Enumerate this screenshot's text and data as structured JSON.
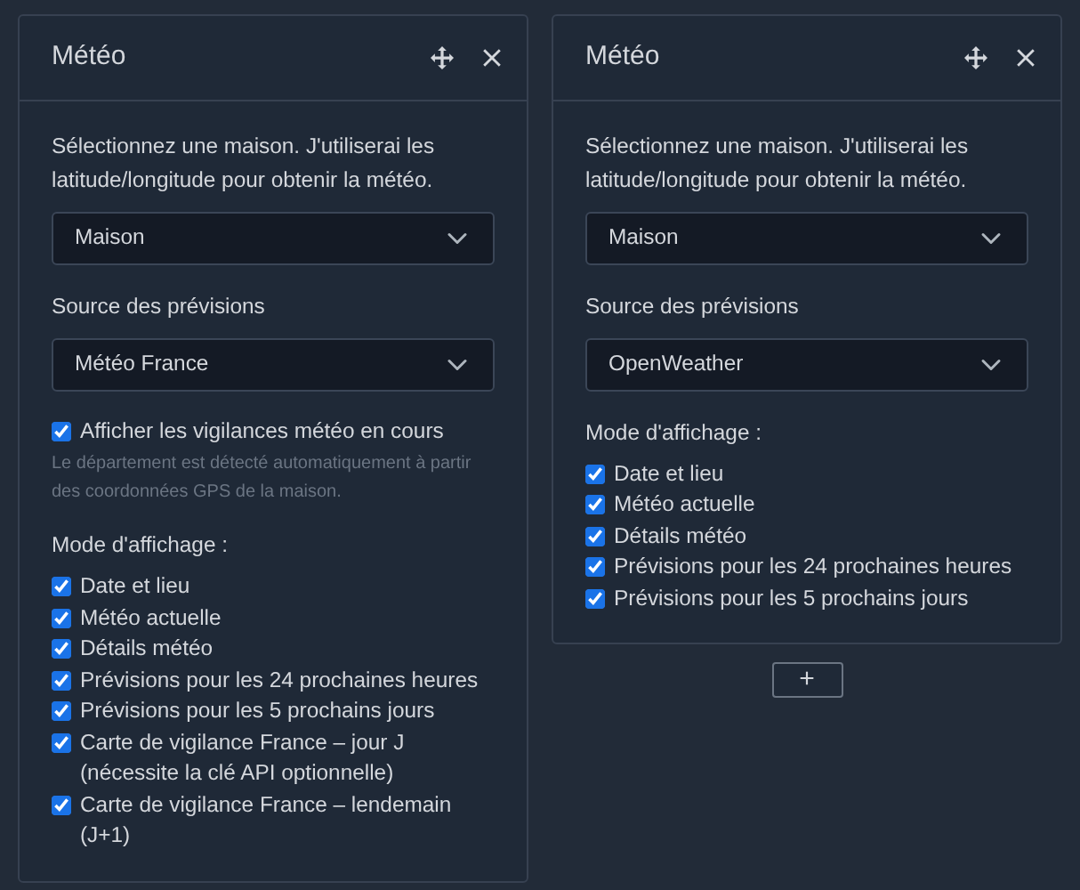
{
  "panels": [
    {
      "title": "Météo",
      "house_prompt": "Sélectionnez une maison. J'utiliserai les latitude/longitude pour obtenir la météo.",
      "house_value": "Maison",
      "source_label": "Source des prévisions",
      "source_value": "Météo France",
      "alert_option": {
        "label": "Afficher les vigilances météo en cours",
        "checked": true,
        "hint": "Le département est détecté automatiquement à partir des coordonnées GPS de la maison."
      },
      "mode_label": "Mode d'affichage :",
      "modes": [
        {
          "label": "Date et lieu",
          "checked": true
        },
        {
          "label": "Météo actuelle",
          "checked": true
        },
        {
          "label": "Détails météo",
          "checked": true
        },
        {
          "label": "Prévisions pour les 24 prochaines heures",
          "checked": true
        },
        {
          "label": "Prévisions pour les 5 prochains jours",
          "checked": true
        },
        {
          "label": "Carte de vigilance France – jour J (nécessite la clé API optionnelle)",
          "checked": true
        },
        {
          "label": "Carte de vigilance France – lendemain (J+1)",
          "checked": true
        }
      ]
    },
    {
      "title": "Météo",
      "house_prompt": "Sélectionnez une maison. J'utiliserai les latitude/longitude pour obtenir la météo.",
      "house_value": "Maison",
      "source_label": "Source des prévisions",
      "source_value": "OpenWeather",
      "mode_label": "Mode d'affichage :",
      "modes": [
        {
          "label": "Date et lieu",
          "checked": true
        },
        {
          "label": "Météo actuelle",
          "checked": true
        },
        {
          "label": "Détails météo",
          "checked": true
        },
        {
          "label": "Prévisions pour les 24 prochaines heures",
          "checked": true
        },
        {
          "label": "Prévisions pour les 5 prochains jours",
          "checked": true
        }
      ],
      "add_label": "+"
    }
  ]
}
